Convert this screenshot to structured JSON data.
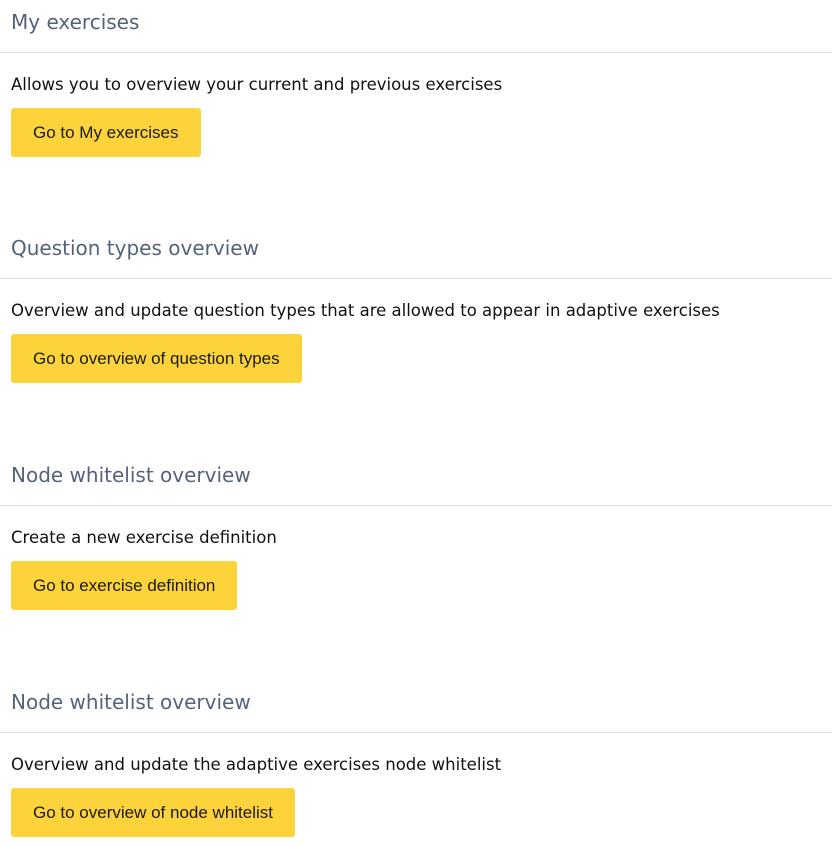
{
  "sections": [
    {
      "title": "My exercises",
      "description": "Allows you to overview your current and previous exercises",
      "button_label": "Go to My exercises"
    },
    {
      "title": "Question types overview",
      "description": "Overview and update question types that are allowed to appear in adaptive exercises",
      "button_label": "Go to overview of question types"
    },
    {
      "title": "Node whitelist overview",
      "description": "Create a new exercise definition",
      "button_label": "Go to exercise definition"
    },
    {
      "title": "Node whitelist overview",
      "description": "Overview and update the adaptive exercises node whitelist",
      "button_label": "Go to overview of node whitelist"
    }
  ],
  "colors": {
    "heading": "#55637a",
    "button_background": "#fdd33c",
    "divider": "#dee2e6"
  }
}
